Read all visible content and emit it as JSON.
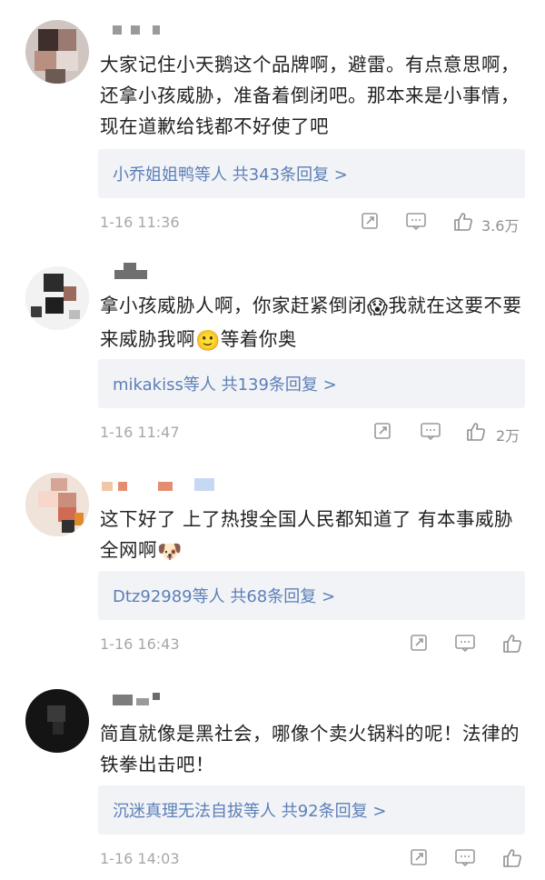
{
  "comments": [
    {
      "text": "大家记住小天鹅这个品牌啊，避雷。有点意思啊，还拿小孩威胁，准备着倒闭吧。那本来是小事情，现在道歉给钱都不好使了吧",
      "reply_summary": "小乔姐姐鸭等人  共343条回复 >",
      "time": "1-16 11:36",
      "likes": "3.6万"
    },
    {
      "text_parts": [
        "拿小孩威胁人啊，你家赶紧倒闭",
        "我就在这要不要来威胁我啊",
        "等着你奥"
      ],
      "emoji_1": "😱",
      "emoji_2": "🙂",
      "reply_summary": "mikakiss等人  共139条回复 >",
      "time": "1-16 11:47",
      "likes": "2万"
    },
    {
      "text_parts": [
        "这下好了 上了热搜全国人民都知道了 有本事威胁全网啊"
      ],
      "emoji_1": "🐶",
      "reply_summary": "Dtz92989等人  共68条回复 >",
      "time": "1-16 16:43",
      "likes": ""
    },
    {
      "text": "简直就像是黑社会，哪像个卖火锅料的呢！法律的铁拳出击吧！",
      "reply_summary": "沉迷真理无法自拔等人  共92条回复 >",
      "time": "1-16 14:03",
      "likes": ""
    }
  ],
  "icons": {
    "share": "share-icon",
    "comment": "comment-icon",
    "like": "thumbs-up-icon"
  },
  "colors": {
    "link": "#5b7fb8",
    "reply_bg": "#f2f3f6",
    "meta": "#a7a7a7"
  }
}
